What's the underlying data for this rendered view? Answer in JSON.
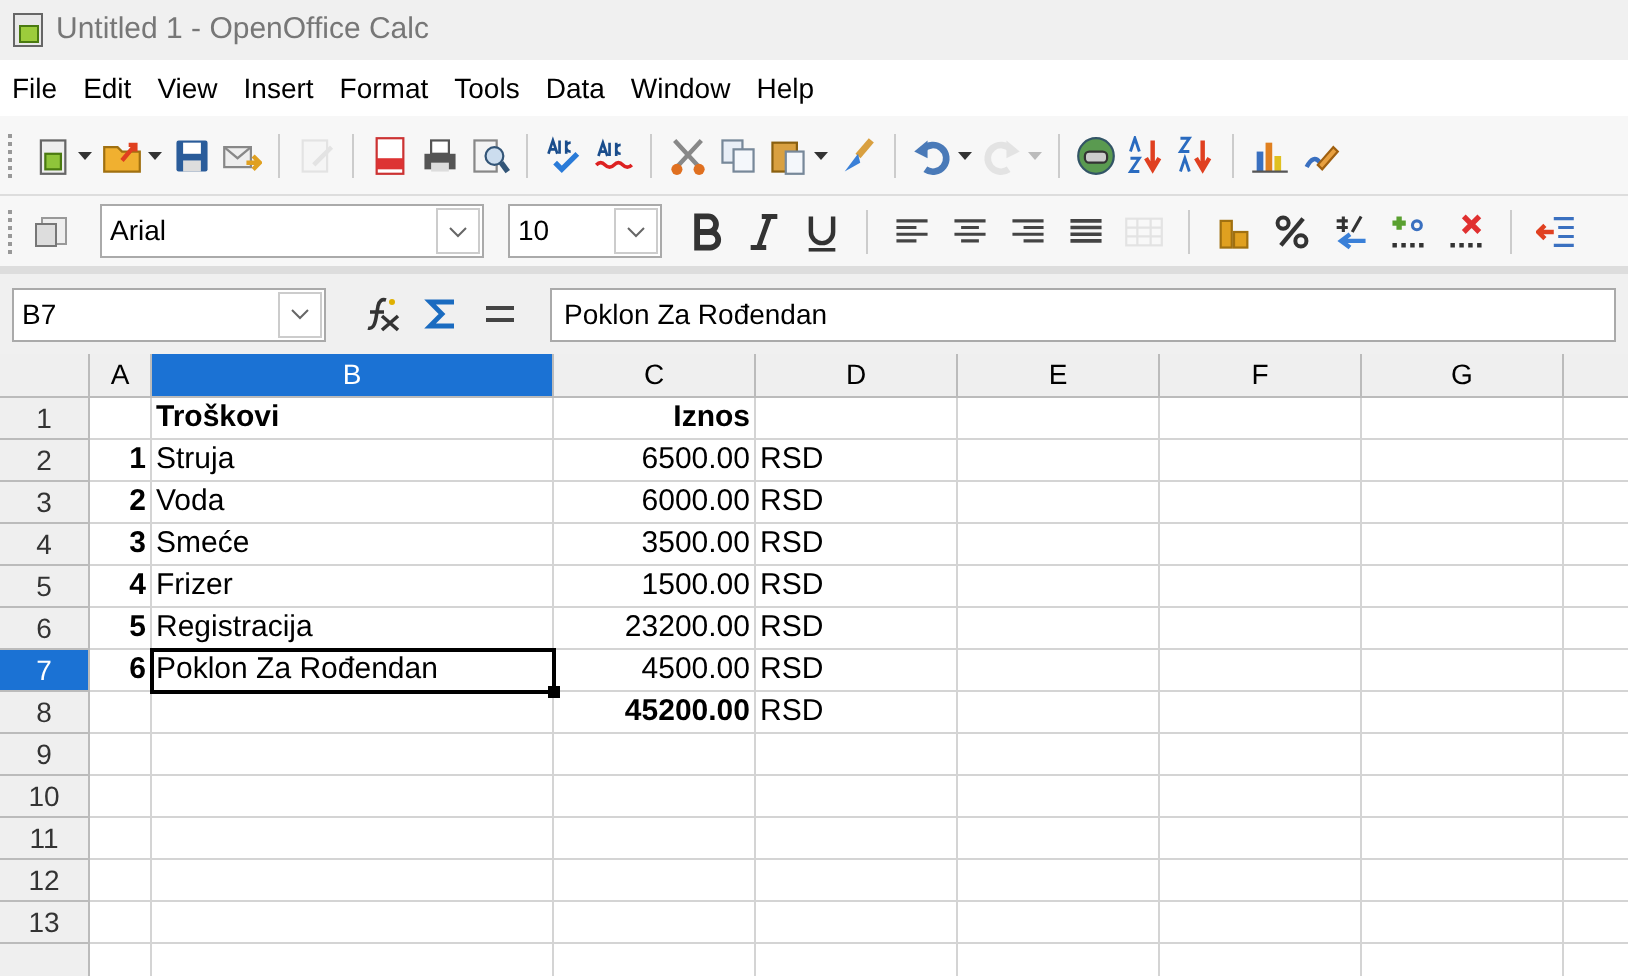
{
  "window": {
    "title": "Untitled 1 - OpenOffice Calc"
  },
  "menu": [
    {
      "label": "File"
    },
    {
      "label": "Edit"
    },
    {
      "label": "View"
    },
    {
      "label": "Insert"
    },
    {
      "label": "Format"
    },
    {
      "label": "Tools"
    },
    {
      "label": "Data"
    },
    {
      "label": "Window"
    },
    {
      "label": "Help"
    }
  ],
  "standard_toolbar": [
    {
      "kind": "new",
      "dropdown": true,
      "disabled": false
    },
    {
      "kind": "open",
      "dropdown": true,
      "disabled": false
    },
    {
      "kind": "save",
      "disabled": false
    },
    {
      "kind": "mail",
      "disabled": false
    },
    {
      "kind": "sep"
    },
    {
      "kind": "edit",
      "disabled": true
    },
    {
      "kind": "sep"
    },
    {
      "kind": "pdf",
      "disabled": false
    },
    {
      "kind": "print",
      "disabled": false
    },
    {
      "kind": "preview",
      "disabled": false
    },
    {
      "kind": "sep"
    },
    {
      "kind": "spell",
      "disabled": false
    },
    {
      "kind": "autospell",
      "disabled": false
    },
    {
      "kind": "sep"
    },
    {
      "kind": "cut",
      "disabled": false
    },
    {
      "kind": "copy",
      "disabled": false
    },
    {
      "kind": "paste",
      "dropdown": true,
      "disabled": false
    },
    {
      "kind": "brush",
      "disabled": false
    },
    {
      "kind": "sep"
    },
    {
      "kind": "undo",
      "dropdown": true,
      "disabled": false
    },
    {
      "kind": "redo",
      "dropdown": true,
      "disabled": true
    },
    {
      "kind": "sep"
    },
    {
      "kind": "navigator",
      "disabled": false
    },
    {
      "kind": "sortasc",
      "disabled": false
    },
    {
      "kind": "sortdesc",
      "disabled": false
    },
    {
      "kind": "sep"
    },
    {
      "kind": "chart",
      "disabled": false
    },
    {
      "kind": "draw",
      "disabled": false
    }
  ],
  "format_toolbar": {
    "font": "Arial",
    "size": "10",
    "buttons": [
      {
        "kind": "bold",
        "disabled": false
      },
      {
        "kind": "italic",
        "disabled": false
      },
      {
        "kind": "underline",
        "disabled": false
      },
      {
        "kind": "sep"
      },
      {
        "kind": "left",
        "disabled": false
      },
      {
        "kind": "center",
        "disabled": false
      },
      {
        "kind": "right",
        "disabled": false
      },
      {
        "kind": "justify",
        "disabled": false
      },
      {
        "kind": "merge",
        "disabled": true
      },
      {
        "kind": "sep"
      },
      {
        "kind": "currency",
        "disabled": false
      },
      {
        "kind": "percent",
        "disabled": false
      },
      {
        "kind": "standard",
        "disabled": false
      },
      {
        "kind": "adddec",
        "disabled": false
      },
      {
        "kind": "deldec",
        "disabled": false
      },
      {
        "kind": "sep"
      },
      {
        "kind": "outdent",
        "disabled": false
      }
    ]
  },
  "formula_bar": {
    "name_box": "B7",
    "content": "Poklon Za Rođendan"
  },
  "columns": [
    {
      "label": "A",
      "selected": false
    },
    {
      "label": "B",
      "selected": true
    },
    {
      "label": "C",
      "selected": false
    },
    {
      "label": "D",
      "selected": false
    },
    {
      "label": "E",
      "selected": false
    },
    {
      "label": "F",
      "selected": false
    },
    {
      "label": "G",
      "selected": false
    }
  ],
  "rows": [
    {
      "label": "1",
      "selected": false,
      "cells": [
        {
          "text": "",
          "bold": false
        },
        {
          "text": "Troškovi",
          "bold": true
        },
        {
          "text": "Iznos",
          "bold": true
        },
        {
          "text": "",
          "bold": false
        }
      ]
    },
    {
      "label": "2",
      "selected": false,
      "cells": [
        {
          "text": "1",
          "bold": true
        },
        {
          "text": "Struja",
          "bold": false
        },
        {
          "text": "6500.00",
          "bold": false
        },
        {
          "text": "RSD",
          "bold": false
        }
      ]
    },
    {
      "label": "3",
      "selected": false,
      "cells": [
        {
          "text": "2",
          "bold": true
        },
        {
          "text": "Voda",
          "bold": false
        },
        {
          "text": "6000.00",
          "bold": false
        },
        {
          "text": "RSD",
          "bold": false
        }
      ]
    },
    {
      "label": "4",
      "selected": false,
      "cells": [
        {
          "text": "3",
          "bold": true
        },
        {
          "text": "Smeće",
          "bold": false
        },
        {
          "text": "3500.00",
          "bold": false
        },
        {
          "text": "RSD",
          "bold": false
        }
      ]
    },
    {
      "label": "5",
      "selected": false,
      "cells": [
        {
          "text": "4",
          "bold": true
        },
        {
          "text": "Frizer",
          "bold": false
        },
        {
          "text": "1500.00",
          "bold": false
        },
        {
          "text": "RSD",
          "bold": false
        }
      ]
    },
    {
      "label": "6",
      "selected": false,
      "cells": [
        {
          "text": "5",
          "bold": true
        },
        {
          "text": "Registracija",
          "bold": false
        },
        {
          "text": "23200.00",
          "bold": false
        },
        {
          "text": "RSD",
          "bold": false
        }
      ]
    },
    {
      "label": "7",
      "selected": true,
      "cells": [
        {
          "text": "6",
          "bold": true
        },
        {
          "text": "Poklon Za Rođendan",
          "bold": false
        },
        {
          "text": "4500.00",
          "bold": false
        },
        {
          "text": "RSD",
          "bold": false
        }
      ]
    },
    {
      "label": "8",
      "selected": false,
      "cells": [
        {
          "text": "",
          "bold": false
        },
        {
          "text": "",
          "bold": false
        },
        {
          "text": "45200.00",
          "bold": true
        },
        {
          "text": "RSD",
          "bold": false
        }
      ]
    },
    {
      "label": "9",
      "selected": false,
      "cells": []
    },
    {
      "label": "10",
      "selected": false,
      "cells": []
    },
    {
      "label": "11",
      "selected": false,
      "cells": []
    },
    {
      "label": "12",
      "selected": false,
      "cells": []
    },
    {
      "label": "13",
      "selected": false,
      "cells": []
    }
  ]
}
